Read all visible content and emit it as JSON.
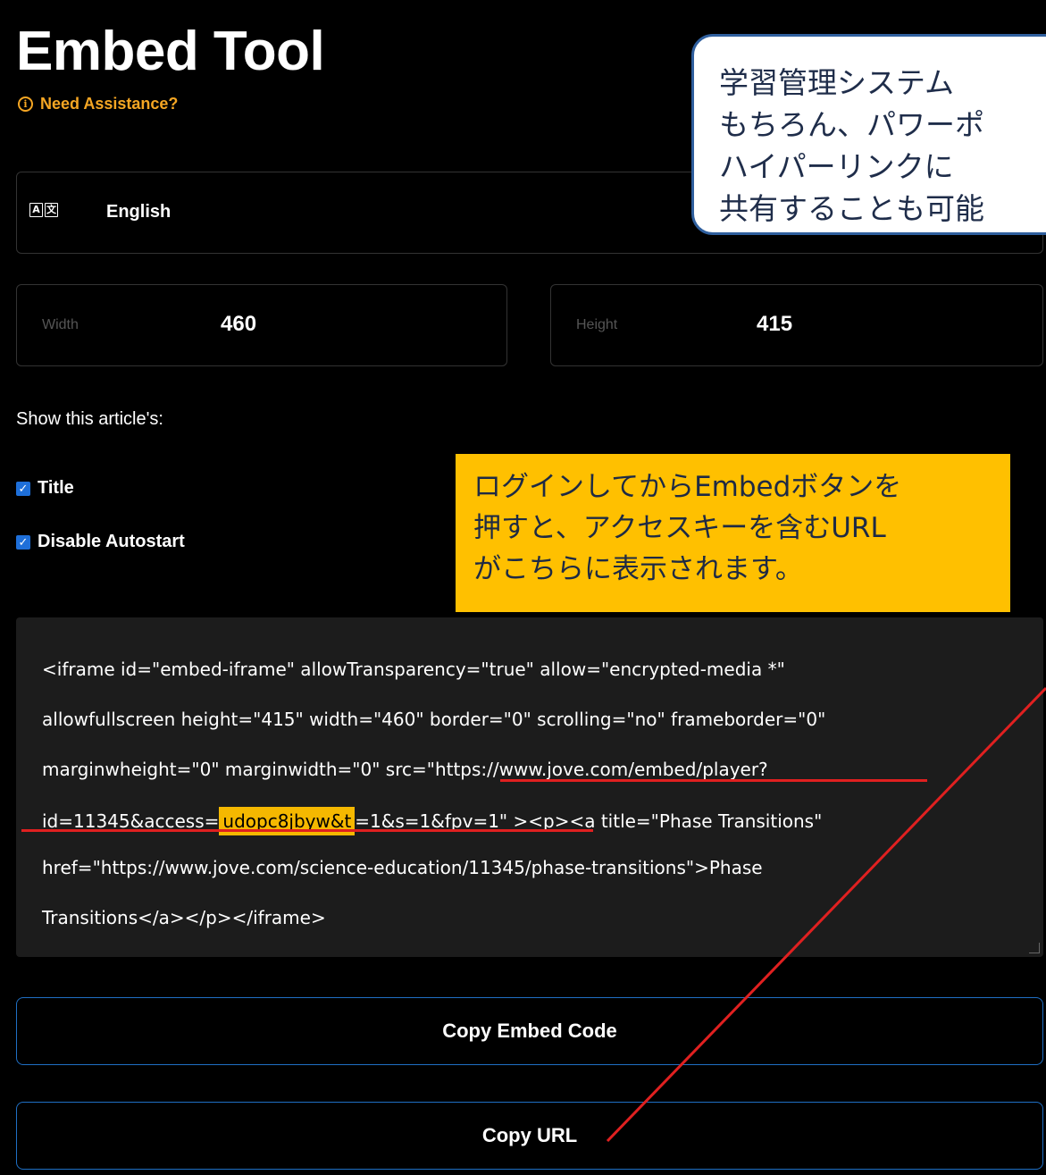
{
  "header": {
    "title": "Embed Tool",
    "help_label": "Need Assistance?"
  },
  "language": {
    "label": "English",
    "icon": "translate-icon"
  },
  "dimensions": {
    "width_label": "Width",
    "width_value": "460",
    "height_label": "Height",
    "height_value": "415"
  },
  "options": {
    "heading": "Show this article's:",
    "title_label": "Title",
    "title_checked": true,
    "autostart_label": "Disable Autostart",
    "autostart_checked": true
  },
  "code": {
    "line1": "<iframe id=\"embed-iframe\" allowTransparency=\"true\" allow=\"encrypted-media *\"",
    "line2": "allowfullscreen height=\"415\" width=\"460\" border=\"0\" scrolling=\"no\" frameborder=\"0\"",
    "line3": "marginwheight=\"0\" marginwidth=\"0\" src=\"https://www.jove.com/embed/player?",
    "line4_pre": "id=11345&access=",
    "line4_key": "udopc8jbyw&t",
    "line4_post": "=1&s=1&fpv=1\" ><p><a title=\"Phase Transitions\"",
    "line5": "href=\"https://www.jove.com/science-education/11345/phase-transitions\">Phase",
    "line6": "Transitions</a></p></iframe>"
  },
  "buttons": {
    "copy_embed": "Copy Embed Code",
    "copy_url": "Copy URL"
  },
  "annotations": {
    "blue_callout_lines": [
      "学習管理システム",
      "もちろん、パワーポ",
      "ハイパーリンクに",
      "共有することも可能"
    ],
    "yellow_callout_lines": [
      "ログインしてからEmbedボタンを",
      "押すと、アクセスキーを含むURL",
      "がこちらに表示されます。"
    ]
  },
  "colors": {
    "accent_orange": "#f5a623",
    "button_border": "#1f6fc4",
    "annotation_red": "#e02020",
    "callout_yellow": "#ffc000"
  }
}
